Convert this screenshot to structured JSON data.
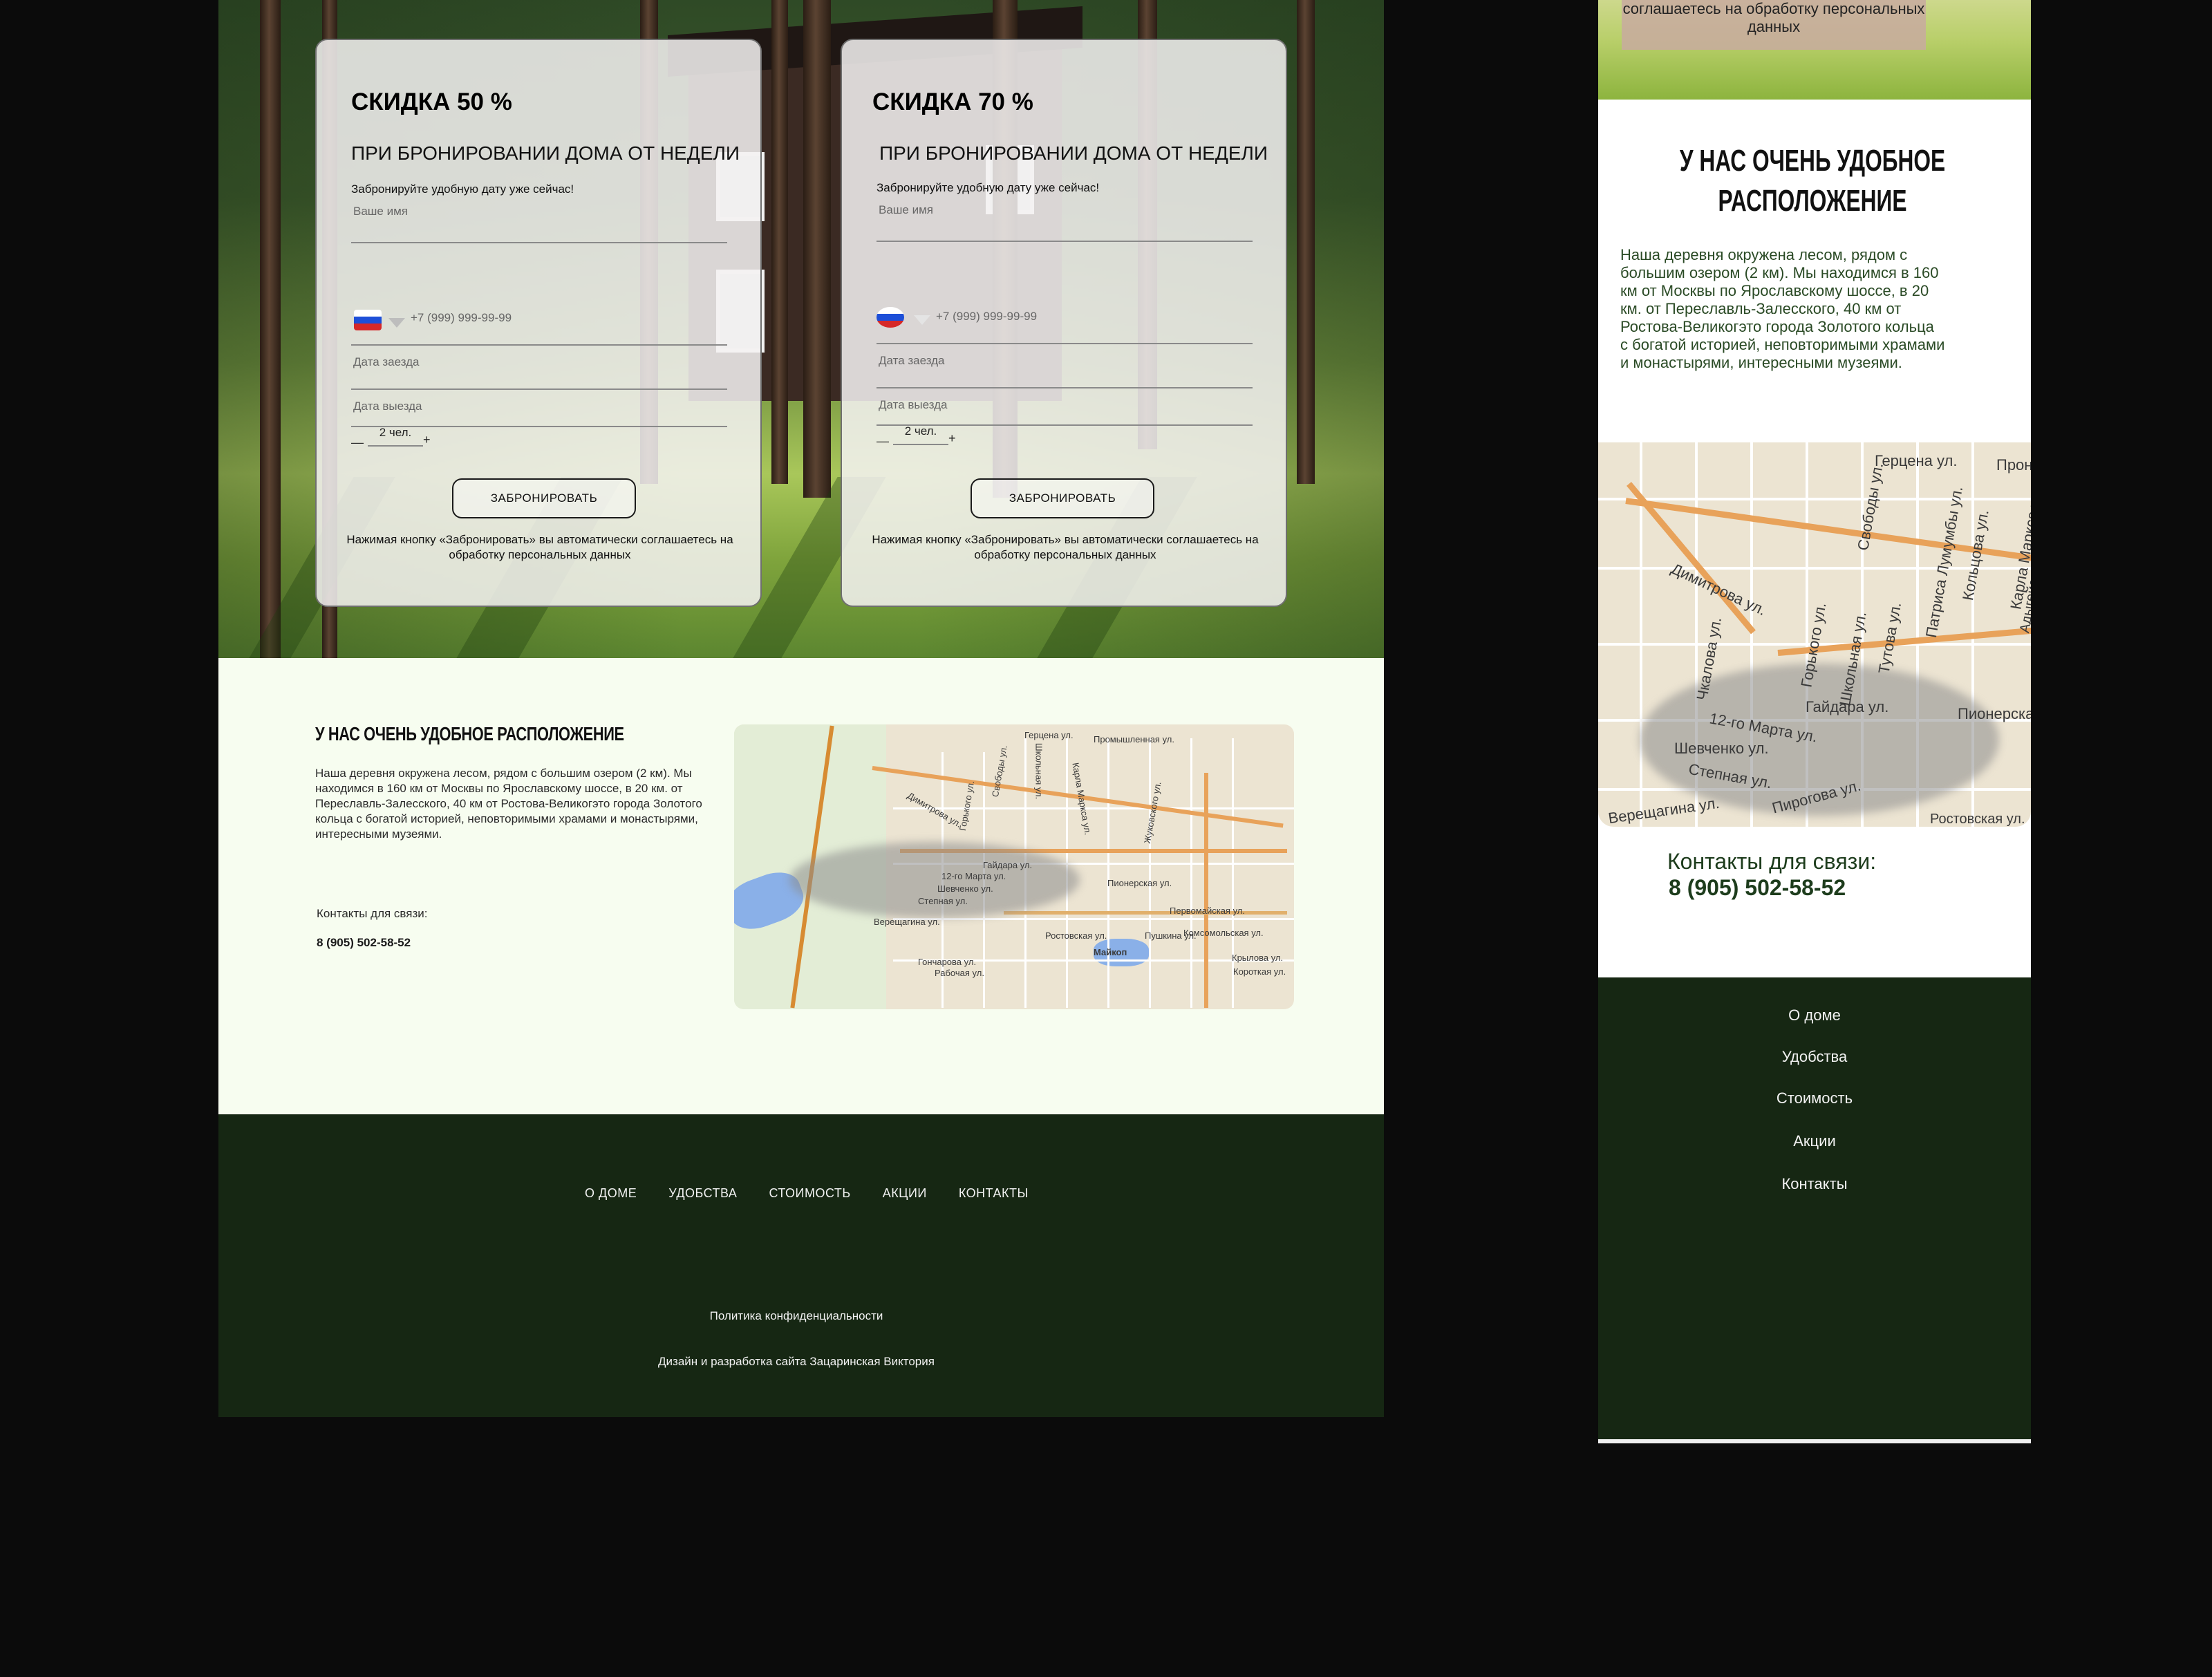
{
  "desktop": {
    "offer_cards": [
      {
        "title": "СКИДКА 50 %",
        "subtitle": "ПРИ БРОНИРОВАНИИ ДОМА ОТ НЕДЕЛИ",
        "note": "Забронируйте удобную дату уже сейчас!",
        "name_placeholder": "Ваше имя",
        "phone_placeholder": "+7 (999) 999-99-99",
        "checkin_placeholder": "Дата заезда",
        "checkout_placeholder": "Дата выезда",
        "guests_minus": "—",
        "guests_value": "2 чел.",
        "guests_plus": "+",
        "button_label": "ЗАБРОНИРОВАТЬ",
        "legal": "Нажимая кнопку «Забронировать» вы автоматически соглашаетесь на обработку персональных данных"
      },
      {
        "title": "СКИДКА 70 %",
        "subtitle": "ПРИ БРОНИРОВАНИИ ДОМА ОТ НЕДЕЛИ",
        "note": "Забронируйте удобную дату уже сейчас!",
        "name_placeholder": "Ваше имя",
        "phone_placeholder": "+7 (999) 999-99-99",
        "checkin_placeholder": "Дата заезда",
        "checkout_placeholder": "Дата выезда",
        "guests_minus": "—",
        "guests_value": "2 чел.",
        "guests_plus": "+",
        "button_label": "ЗАБРОНИРОВАТЬ",
        "legal": "Нажимая кнопку «Забронировать» вы автоматически соглашаетесь на обработку персональных данных"
      }
    ],
    "location": {
      "title": "У НАС ОЧЕНЬ УДОБНОЕ  РАСПОЛОЖЕНИЕ",
      "text": "Наша деревня окружена лесом, рядом с большим озером (2 км). Мы находимся в 160 км от Москвы по Ярославскому шоссе, в 20 км. от Переславль-Залесского, 40 км от Ростова-Великогэто города Золотого кольца с богатой историей, неповторимыми храмами и монастырями, интересными музеями.",
      "contacts_label": "Контакты для связи:",
      "phone": "8 (905) 502-58-52",
      "map_labels": [
        "Герцена ул.",
        "Промышленная ул.",
        "Димитрова ул.",
        "Гайдара ул.",
        "12-го Марта ул.",
        "Шевченко ул.",
        "Степная ул.",
        "Верещагина ул.",
        "Пионерская ул.",
        "Ростовская ул.",
        "Комсомольская ул.",
        "Первомайская ул.",
        "Пушкина ул.",
        "Крылова ул.",
        "Короткая ул.",
        "Гончарова ул.",
        "Рабочая ул.",
        "Майкоп",
        "Школьная ул.",
        "Свободы ул.",
        "Горького ул.",
        "Жуковского ул.",
        "Карла Маркса ул."
      ]
    },
    "footer": {
      "nav": [
        "О ДОМЕ",
        "УДОБСТВА",
        "СТОИМОСТЬ",
        "АКЦИИ",
        "КОНТАКТЫ"
      ],
      "policy": "Политика конфиденциальности",
      "credit": "Дизайн и разработка сайта Зацаринская Виктория"
    }
  },
  "mobile": {
    "hero_note": "соглашаетесь на обработку персональных данных",
    "title": "У НАС ОЧЕНЬ УДОБНОЕ РАСПОЛОЖЕНИЕ",
    "text": "Наша деревня окружена лесом, рядом с большим озером (2 км). Мы находимся в 160 км от Москвы по Ярославскому шоссе, в 20 км. от Переславль-Залесского, 40 км от Ростова-Великогэто города Золотого кольца с богатой историей, неповторимыми храмами и монастырями, интересными музеями.",
    "map_labels": [
      "Герцена ул.",
      "Свободы ул.",
      "Патриса Лумумбы ул.",
      "Кольцова ул.",
      "Карла Маркса ул.",
      "Димитрова ул.",
      "Чкалова ул.",
      "Горького ул.",
      "Школьная ул.",
      "Тутова ул.",
      "Гайдара ул.",
      "12-го Марта ул.",
      "Шевченко ул.",
      "Степная ул.",
      "Верещагина ул.",
      "Пирогова ул.",
      "Пионерская",
      "Ростовская ул.",
      "Прон",
      "Адыгейская"
    ],
    "contacts_label": "Контакты для связи:",
    "phone": "8 (905) 502-58-52",
    "nav": [
      "О доме",
      "Удобства",
      "Стоимость",
      "Акции",
      "Контакты"
    ]
  },
  "colors": {
    "footer_bg": "#162713",
    "location_bg": "#f7fdf0",
    "page_bg": "#0b0b0b",
    "accent_road": "#e8a25a",
    "mobile_text": "#1d3c1c"
  },
  "icons": [
    "russia-flag-icon",
    "chevron-down-icon"
  ]
}
